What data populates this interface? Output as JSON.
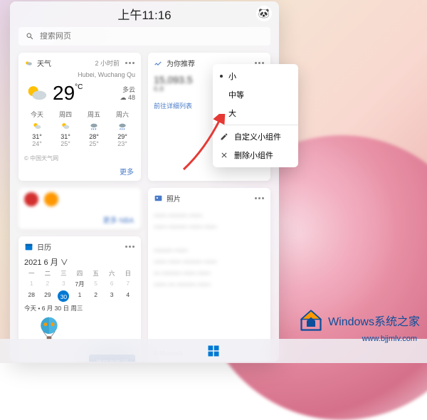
{
  "clock": "上午11:16",
  "avatar_emoji": "🐼",
  "search": {
    "placeholder": "搜索网页"
  },
  "weather": {
    "title": "天气",
    "meta": "2 小时前",
    "location": "Hubei, Wuchang Qu",
    "temp": "29",
    "unit": "°C",
    "cond": "多云",
    "aqi": "☁ 48",
    "forecast": [
      {
        "d": "今天",
        "hi": "31°",
        "lo": "24°"
      },
      {
        "d": "周四",
        "hi": "31°",
        "lo": "25°"
      },
      {
        "d": "周五",
        "hi": "28°",
        "lo": "25°"
      },
      {
        "d": "周六",
        "hi": "29°",
        "lo": "23°"
      }
    ],
    "source": "© 中国天气网",
    "more": "更多"
  },
  "sports": {
    "more": "更多 NBA"
  },
  "recommend": {
    "title": "为你推荐",
    "number": "15,093.5",
    "sub": "6.8",
    "link": "前往详细列表"
  },
  "photos": {
    "title": "照片",
    "source": "© Microsoft"
  },
  "calendar": {
    "title": "日历",
    "month": "2021 6 月 ∨",
    "dow": [
      "一",
      "二",
      "三",
      "四",
      "五",
      "六",
      "日"
    ],
    "row1": [
      "1",
      "2",
      "3",
      "7月",
      "5",
      "6",
      "7"
    ],
    "row2": [
      "28",
      "29",
      "30",
      "1",
      "2",
      "3",
      "4"
    ],
    "event": "今天 • 6 月 30 日 周三",
    "btn": "跳转到新闻"
  },
  "menu": {
    "small": "小",
    "medium": "中等",
    "large": "大",
    "customize": "自定义小组件",
    "remove": "删除小组件"
  },
  "watermark": {
    "text": "Windows系统之家",
    "url": "www.bjjmlv.com"
  }
}
